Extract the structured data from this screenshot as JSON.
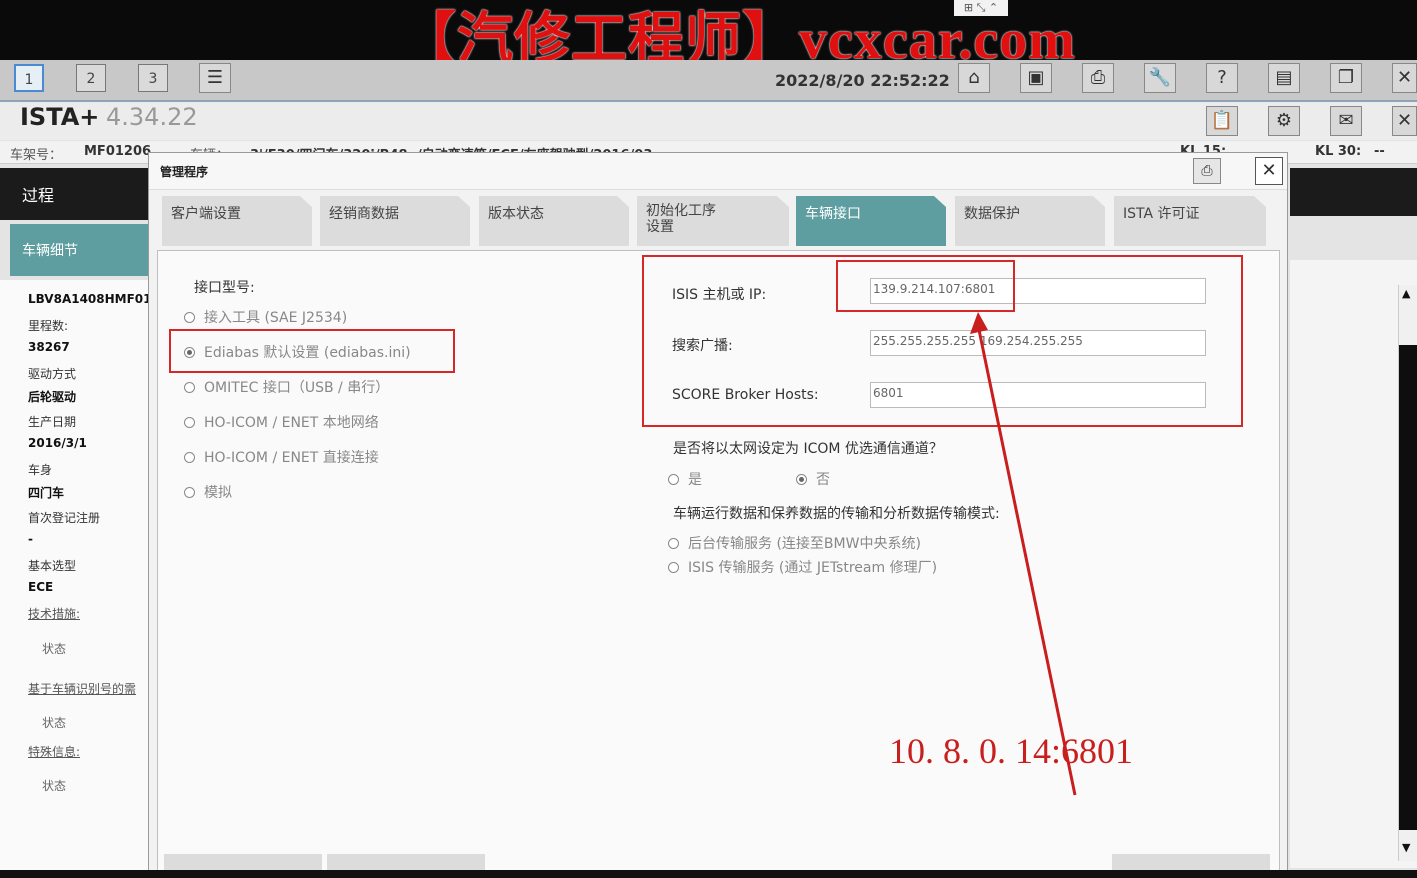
{
  "banner": {
    "text": "【汽修工程师】vcxcar.com",
    "widget": "⊞ ⤡ ⌃"
  },
  "toolbar": {
    "pages": [
      "1",
      "2",
      "3"
    ],
    "datetime": "2022/8/20 22:52:22"
  },
  "app": {
    "name": "ISTA+",
    "version": "4.34.22"
  },
  "vehicle_row": {
    "chassis_label": "车架号：",
    "chassis_value": "MF01206",
    "series_label": "车辆：",
    "series_value": "3'/F30/四门车/320i/B48 ,/自动变速箱/ECE/左座驾驶型/2016/03",
    "kl15_label": "KL 15:",
    "kl30_label": "KL 30:",
    "kl30_value": "--"
  },
  "left_panel": {
    "header": "过程",
    "section": "车辆细节",
    "vin": "LBV8A1408HMF01",
    "mileage_label": "里程数:",
    "mileage": "38267",
    "drive_label": "驱动方式",
    "drive": "后轮驱动",
    "production_label": "生产日期",
    "production": "2016/3/1",
    "body_label": "车身",
    "body": "四门车",
    "first_reg_label": "首次登记注册",
    "first_reg": "-",
    "base_type_label": "基本选型",
    "base_type": "ECE",
    "tech_measures": "技术措施:",
    "status": "状态",
    "vin_based": "基于车辆识别号的需",
    "special_info": "特殊信息:"
  },
  "dialog": {
    "title": "管理程序",
    "tabs": [
      "客户端设置",
      "经销商数据",
      "版本状态",
      "初始化工序\n设置",
      "车辆接口",
      "数据保护",
      "ISTA 许可证"
    ],
    "interface_type_label": "接口型号:",
    "interface_options": [
      "接入工具 (SAE J2534)",
      "Ediabas 默认设置 (ediabas.ini)",
      "OMITEC 接口（USB / 串行）",
      "HO-ICOM / ENET 本地网络",
      "HO-ICOM / ENET 直接连接",
      "模拟"
    ],
    "isis_label": "ISIS 主机或 IP:",
    "isis_value": "139.9.214.107:6801",
    "broadcast_label": "搜索广播:",
    "broadcast_value": "255.255.255.255 169.254.255.255",
    "score_label": "SCORE Broker Hosts:",
    "score_value": "6801",
    "ethernet_question": "是否将以太网设定为 ICOM 优选通信通道？",
    "yes": "是",
    "no": "否",
    "transfer_question": "车辆运行数据和保养数据的传输和分析数据传输模式:",
    "transfer_options": [
      "后台传输服务 (连接至BMW中央系统)",
      "ISIS 传输服务 (通过 JETstream 修理厂)"
    ]
  },
  "annotation": "10. 8. 0. 14:6801",
  "colors": {
    "accent": "#5f9ea0",
    "annotation_red": "#d62828",
    "banner_red": "#e01010"
  }
}
